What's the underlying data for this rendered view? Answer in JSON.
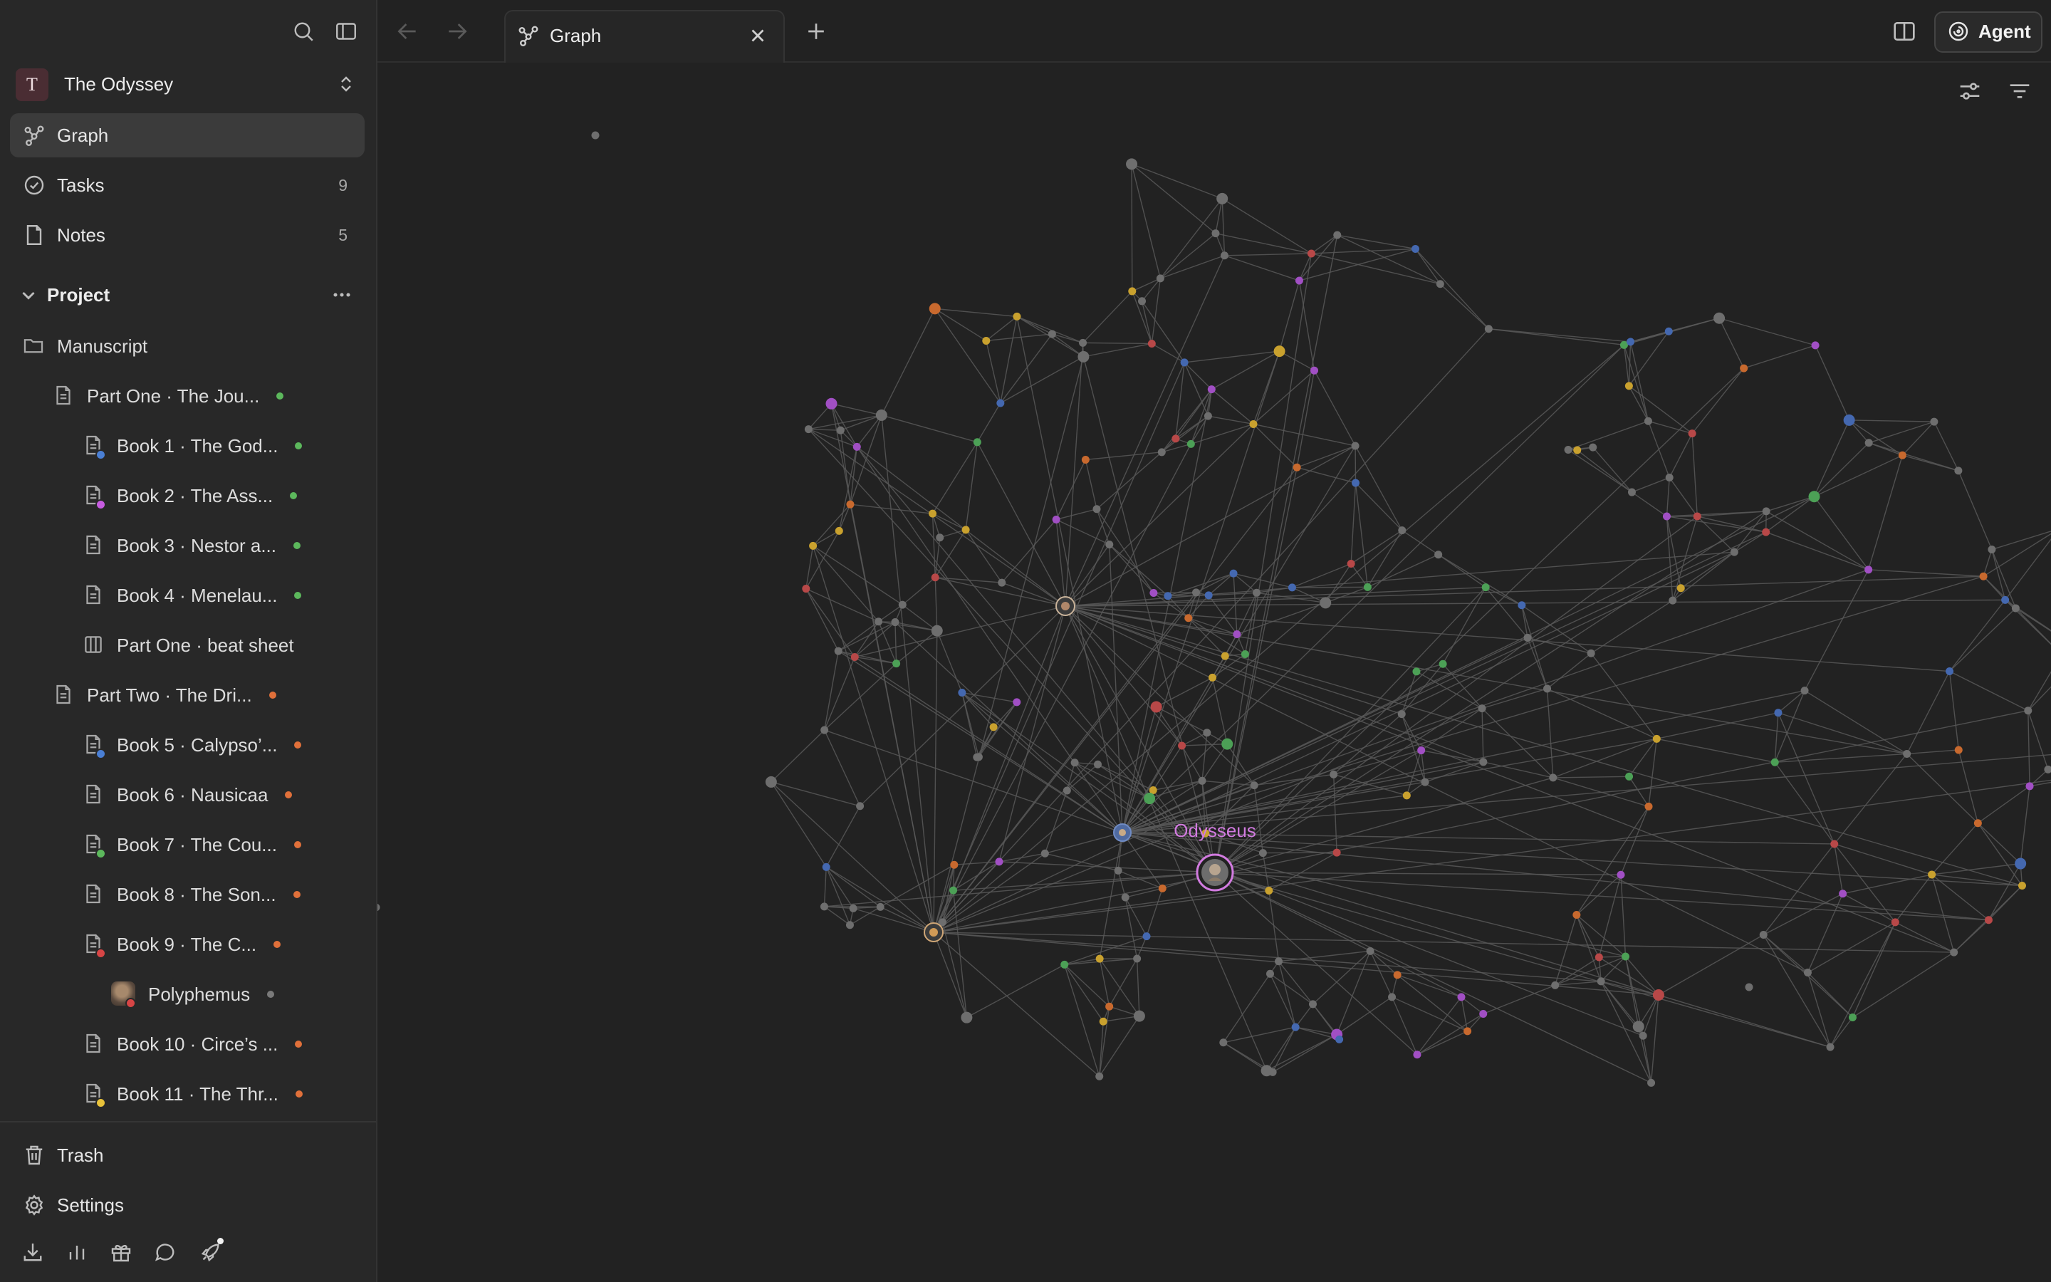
{
  "workspace": {
    "avatar_letter": "T",
    "name": "The Odyssey"
  },
  "nav": [
    {
      "label": "Graph",
      "count": "",
      "icon": "graph-icon",
      "active": true
    },
    {
      "label": "Tasks",
      "count": "9",
      "icon": "check-circle-icon",
      "active": false
    },
    {
      "label": "Notes",
      "count": "5",
      "icon": "note-icon",
      "active": false
    }
  ],
  "project": {
    "section_label": "Project",
    "folder_label": "Manuscript",
    "items": [
      {
        "label": "Part One · The Jou...",
        "type": "doc",
        "level": 1,
        "status_color": "#5cb85c"
      },
      {
        "label": "Book 1 · The God...",
        "type": "doc",
        "level": 2,
        "status_color": "#5cb85c",
        "mini_color": "#4a7fd4"
      },
      {
        "label": "Book 2 · The Ass...",
        "type": "doc",
        "level": 2,
        "status_color": "#5cb85c",
        "mini_color": "#c75ce0"
      },
      {
        "label": "Book 3 · Nestor a...",
        "type": "doc",
        "level": 2,
        "status_color": "#5cb85c"
      },
      {
        "label": "Book 4 · Menelau...",
        "type": "doc",
        "level": 2,
        "status_color": "#5cb85c"
      },
      {
        "label": "Part One · beat sheet",
        "type": "board",
        "level": 2
      },
      {
        "label": "Part Two · The Dri...",
        "type": "doc",
        "level": 1,
        "status_color": "#e0703a"
      },
      {
        "label": "Book 5 · Calypso’...",
        "type": "doc",
        "level": 2,
        "status_color": "#e0703a",
        "mini_color": "#4a7fd4"
      },
      {
        "label": "Book 6 · Nausicaa",
        "type": "doc",
        "level": 2,
        "status_color": "#e0703a"
      },
      {
        "label": "Book 7 · The Cou...",
        "type": "doc",
        "level": 2,
        "status_color": "#e0703a",
        "mini_color": "#5cb85c"
      },
      {
        "label": "Book 8 · The Son...",
        "type": "doc",
        "level": 2,
        "status_color": "#e0703a"
      },
      {
        "label": "Book 9 · The C...",
        "type": "doc",
        "level": 2,
        "status_color": "#e0703a",
        "mini_color": "#d64545"
      },
      {
        "label": "Polyphemus",
        "type": "character",
        "level": 3,
        "status_color": "#7a7a7a",
        "mini_color": "#d64545"
      },
      {
        "label": "Book 10 · Circe’s ...",
        "type": "doc",
        "level": 2,
        "status_color": "#e0703a"
      },
      {
        "label": "Book 11 · The Thr...",
        "type": "doc",
        "level": 2,
        "status_color": "#e0703a",
        "mini_color": "#e8c23a"
      }
    ]
  },
  "footer": {
    "trash_label": "Trash",
    "settings_label": "Settings",
    "tool_icons": [
      "download-icon",
      "bar-chart-icon",
      "gift-icon",
      "chat-bubble-icon",
      "rocket-icon"
    ]
  },
  "tabbar": {
    "tab_label": "Graph",
    "agent_label": "Agent"
  },
  "graph": {
    "highlight_label": "Odysseus",
    "colors": {
      "gray": "#6e6e6e",
      "red": "#b84848",
      "orange": "#c8692e",
      "yellow": "#c9a12e",
      "green": "#4ca056",
      "blue": "#4468b0",
      "purple": "#a14fc4",
      "edge": "#585858",
      "label": "#d27be0"
    }
  }
}
